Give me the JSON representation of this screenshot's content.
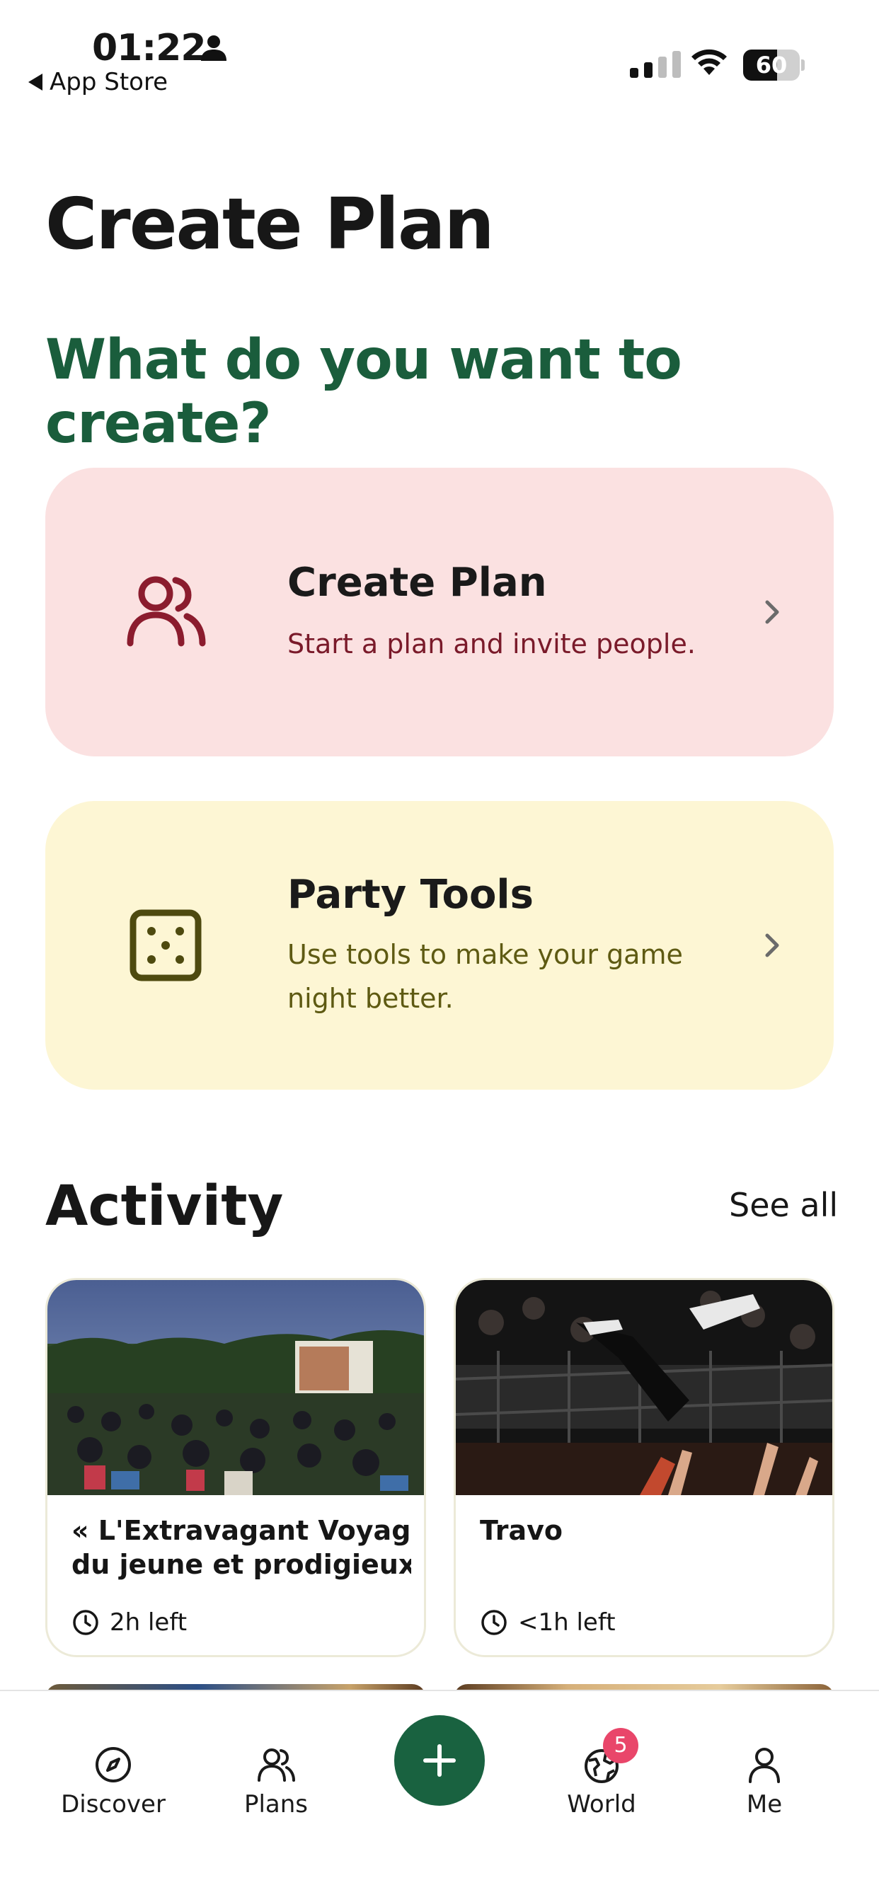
{
  "status_bar": {
    "time": "01:22",
    "back_label": "App Store",
    "battery_level": "60",
    "battery_fraction": 0.6,
    "signal_bars_active": 2,
    "signal_bars_total": 4
  },
  "header": {
    "title": "Create Plan",
    "question": "What do you want to create?"
  },
  "options": [
    {
      "title": "Create Plan",
      "description": "Start a plan and invite people.",
      "icon": "people-icon",
      "background": "#fbe1e1",
      "accent": "#8b1c2e"
    },
    {
      "title": "Party Tools",
      "description": "Use tools to make your game night better.",
      "icon": "dice-icon",
      "background": "#fdf6d4",
      "accent": "#5e5a12"
    }
  ],
  "activity": {
    "title": "Activity",
    "see_all": "See all",
    "items": [
      {
        "name_line1": "« L'Extravagant Voyage",
        "name_line2": "du jeune et prodigieux T...",
        "time_left": "2h left",
        "image": "outdoor-cinema-photo"
      },
      {
        "name_line1": "Travo",
        "name_line2": "",
        "time_left": "<1h left",
        "image": "concert-crowd-photo"
      }
    ]
  },
  "tabbar": {
    "tabs": [
      {
        "label": "Discover",
        "icon": "compass-icon"
      },
      {
        "label": "Plans",
        "icon": "people-icon"
      },
      {
        "label": "World",
        "icon": "globe-icon",
        "badge": "5"
      },
      {
        "label": "Me",
        "icon": "person-icon"
      }
    ],
    "fab_icon": "plus-icon",
    "fab_color": "#196240"
  },
  "colors": {
    "brand_green": "#1a5d3c",
    "badge_pink": "#e9466a"
  }
}
